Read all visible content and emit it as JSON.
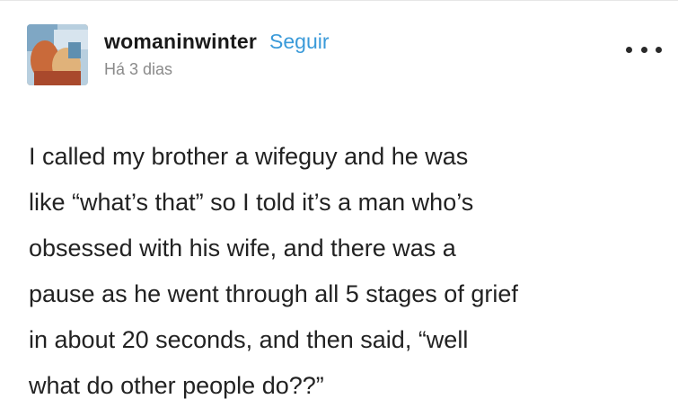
{
  "post": {
    "author": {
      "username": "womaninwinter",
      "avatar_icon": "avatar-image",
      "follow_label": "Seguir",
      "follow_color": "#3a9ad9"
    },
    "timestamp": "Há 3 dias",
    "menu_icon": "more-options-icon",
    "body_lines": [
      "I called my brother a wifeguy and he was",
      "like “what’s that” so I told it’s a man who’s",
      "obsessed with his wife, and there was a",
      "pause as he went through all 5 stages of grief",
      "in about 20 seconds, and then said, “well",
      "what do other people do??”"
    ]
  }
}
